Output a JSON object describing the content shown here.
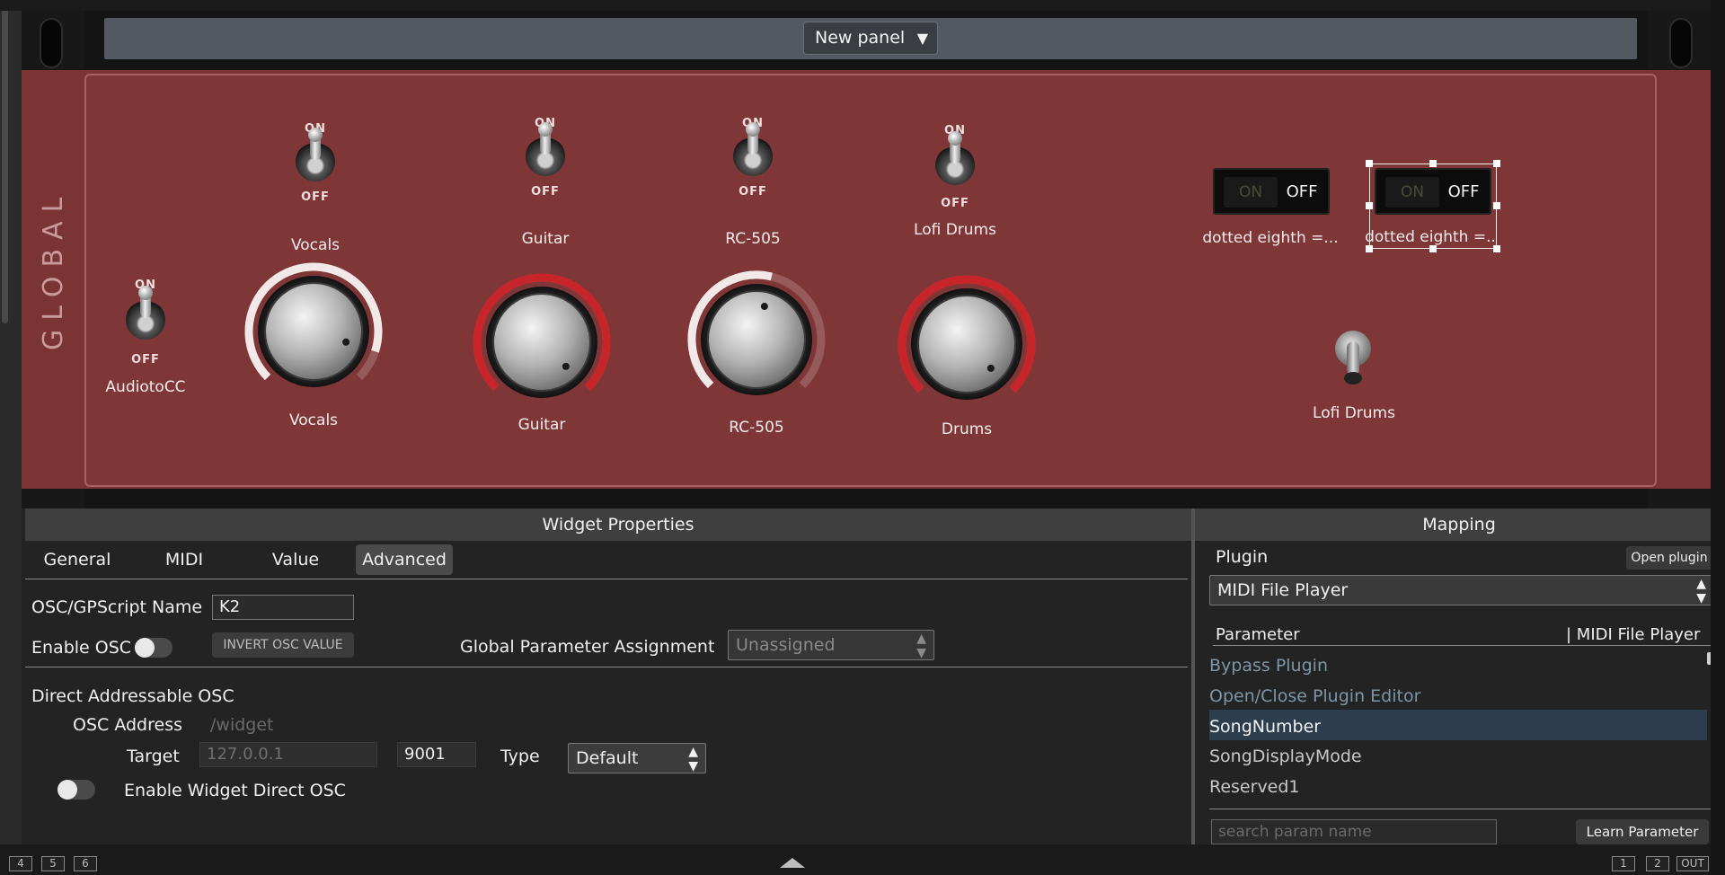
{
  "panel_selector": {
    "label": "New panel",
    "arrow": "▼"
  },
  "rack": {
    "side_label": "GLOBAL"
  },
  "toggles": [
    {
      "on": "ON",
      "off": "OFF",
      "label": "Vocals"
    },
    {
      "on": "ON",
      "off": "OFF",
      "label": "Guitar"
    },
    {
      "on": "ON",
      "off": "OFF",
      "label": "RC-505"
    },
    {
      "on": "ON",
      "off": "OFF",
      "label": "Lofi Drums"
    },
    {
      "on": "ON",
      "off": "OFF",
      "label": "AudiotoCC"
    }
  ],
  "knobs": [
    {
      "label": "Vocals",
      "value_fraction": 0.9,
      "ring_color": "#f2e8e8"
    },
    {
      "label": "Guitar",
      "value_fraction": 1.0,
      "ring_color": "#c8252a"
    },
    {
      "label": "RC-505",
      "value_fraction": 0.55,
      "ring_color": "#f2e8e8"
    },
    {
      "label": "Drums",
      "value_fraction": 1.0,
      "ring_color": "#c8252a"
    }
  ],
  "rockers": [
    {
      "on": "ON",
      "off": "OFF",
      "label": "dotted eighth =..."
    },
    {
      "on": "ON",
      "off": "OFF",
      "label": "dotted eighth =.."
    }
  ],
  "lofi_switch": {
    "label": "Lofi Drums"
  },
  "widget_properties": {
    "title": "Widget Properties",
    "tabs": [
      "General",
      "MIDI",
      "Value",
      "Advanced"
    ],
    "active_tab": "Advanced",
    "osc_name_label": "OSC/GPScript Name",
    "osc_name_value": "K2",
    "enable_osc_label": "Enable OSC",
    "invert_button": "INVERT OSC VALUE",
    "global_param_label": "Global Parameter Assignment",
    "global_param_value": "Unassigned",
    "direct_osc_title": "Direct Addressable OSC",
    "osc_address_label": "OSC Address",
    "osc_address_placeholder": "/widget",
    "target_label": "Target",
    "target_placeholder": "127.0.0.1",
    "port_value": "9001",
    "type_label": "Type",
    "type_value": "Default",
    "enable_direct_label": "Enable Widget Direct OSC"
  },
  "mapping": {
    "title": "Mapping",
    "plugin_label": "Plugin",
    "open_plugin_button": "Open plugin",
    "plugin_value": "MIDI File Player",
    "param_col": "Parameter",
    "plugin_col": "| MIDI File Player",
    "items": [
      "Bypass Plugin",
      "Open/Close Plugin Editor",
      "SongNumber",
      "SongDisplayMode",
      "Reserved1"
    ],
    "selected_index": 2,
    "search_placeholder": "search param name",
    "learn_button": "Learn Parameter"
  },
  "status_bar": {
    "left_buttons": [
      "4",
      "5",
      "6"
    ],
    "right_buttons": [
      "1",
      "2",
      "OUT"
    ]
  },
  "colors": {
    "accent_blue": "#7c96a6",
    "selected_row": "#2c3e4e"
  }
}
